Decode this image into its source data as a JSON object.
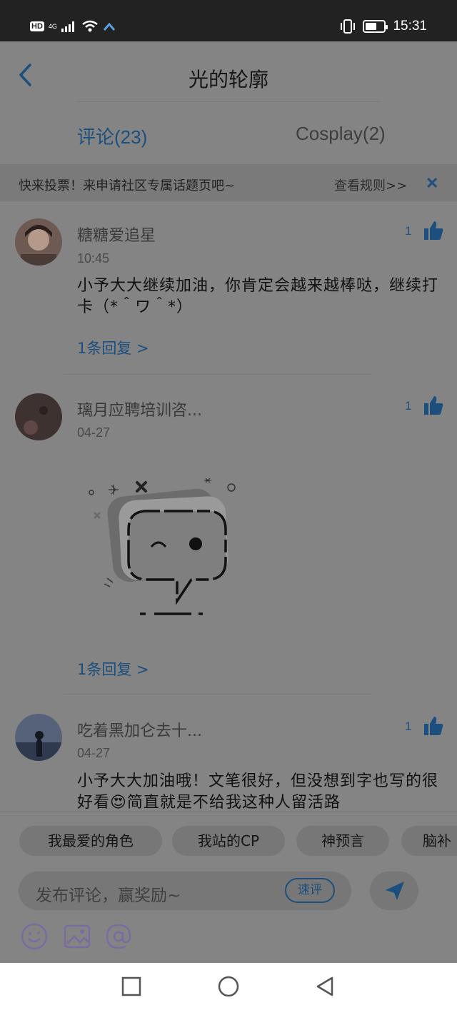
{
  "status_bar": {
    "hd": "HD",
    "network": "4G",
    "time": "15:31",
    "battery_percent": 60
  },
  "header": {
    "title": "光的轮廓"
  },
  "tabs": [
    {
      "label": "评论(23)",
      "active": true
    },
    {
      "label": "Cosplay(2)",
      "active": false
    }
  ],
  "notice": {
    "text": "快来投票！来申请社区专属话题页吧~",
    "link": "查看规则>>",
    "close": "✕"
  },
  "comments": [
    {
      "username": "糖糖爱追星",
      "time": "10:45",
      "likes": "1",
      "text": "小予大大继续加油，你肯定会越来越棒哒，继续打卡（*＾ワ＾*）",
      "reply": "1条回复 >"
    },
    {
      "username": "璃月应聘培训咨...",
      "time": "04-27",
      "likes": "1",
      "text": "",
      "reply": "1条回复 >"
    },
    {
      "username": "吃着黑加仑去十...",
      "time": "04-27",
      "likes": "1",
      "text": "小予大大加油哦！文笔很好，但没想到字也写的很好看😍简直就是不给我这种人留活路",
      "reply": ""
    }
  ],
  "chips": [
    "我最爱的角色",
    "我站的CP",
    "神预言",
    "脑补"
  ],
  "composer": {
    "placeholder": "发布评论，赢奖励~",
    "quick_label": "速评"
  },
  "icons": {
    "accent": "#1c4f7e",
    "tools": [
      "emoji-icon",
      "image-icon",
      "mention-icon"
    ]
  }
}
